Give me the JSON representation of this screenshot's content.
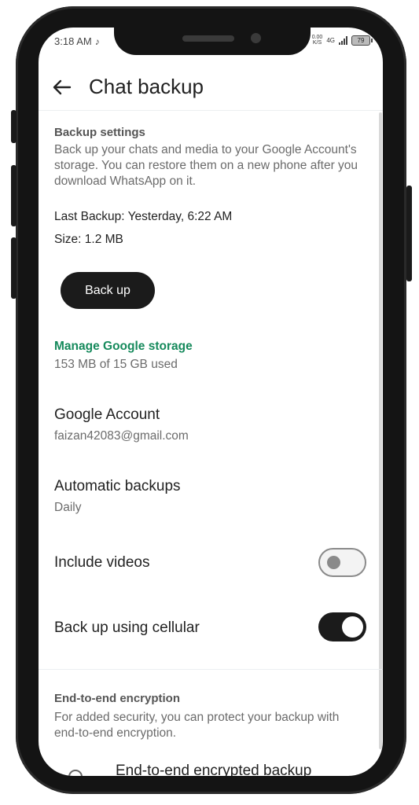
{
  "status_bar": {
    "time": "3:18 AM",
    "tiktok_glyph": "♪",
    "net_speed_value": "0.00",
    "net_speed_unit": "K/S",
    "network": "4G",
    "battery": "79"
  },
  "appbar": {
    "title": "Chat backup"
  },
  "backup_settings": {
    "heading": "Backup settings",
    "description": "Back up your chats and media to your Google Account's storage. You can restore them on a new phone after you download WhatsApp on it.",
    "last_backup": "Last Backup: Yesterday, 6:22 AM",
    "size": "Size: 1.2 MB",
    "backup_button": "Back up"
  },
  "storage": {
    "link": "Manage Google storage",
    "usage": "153 MB of 15 GB used"
  },
  "google_account": {
    "label": "Google Account",
    "value": "faizan42083@gmail.com"
  },
  "automatic_backups": {
    "label": "Automatic backups",
    "value": "Daily"
  },
  "include_videos": {
    "label": "Include videos",
    "enabled": false
  },
  "cellular": {
    "label": "Back up using cellular",
    "enabled": true
  },
  "encryption": {
    "heading": "End-to-end encryption",
    "description": "For added security, you can protect your backup with end-to-end encryption.",
    "item_label": "End-to-end encrypted backup"
  },
  "colors": {
    "accent_green": "#168a5c",
    "button_dark": "#1b1b1b"
  },
  "icons": [
    "back-arrow-icon",
    "tiktok-icon",
    "signal-icon",
    "battery-icon",
    "lock-icon"
  ]
}
